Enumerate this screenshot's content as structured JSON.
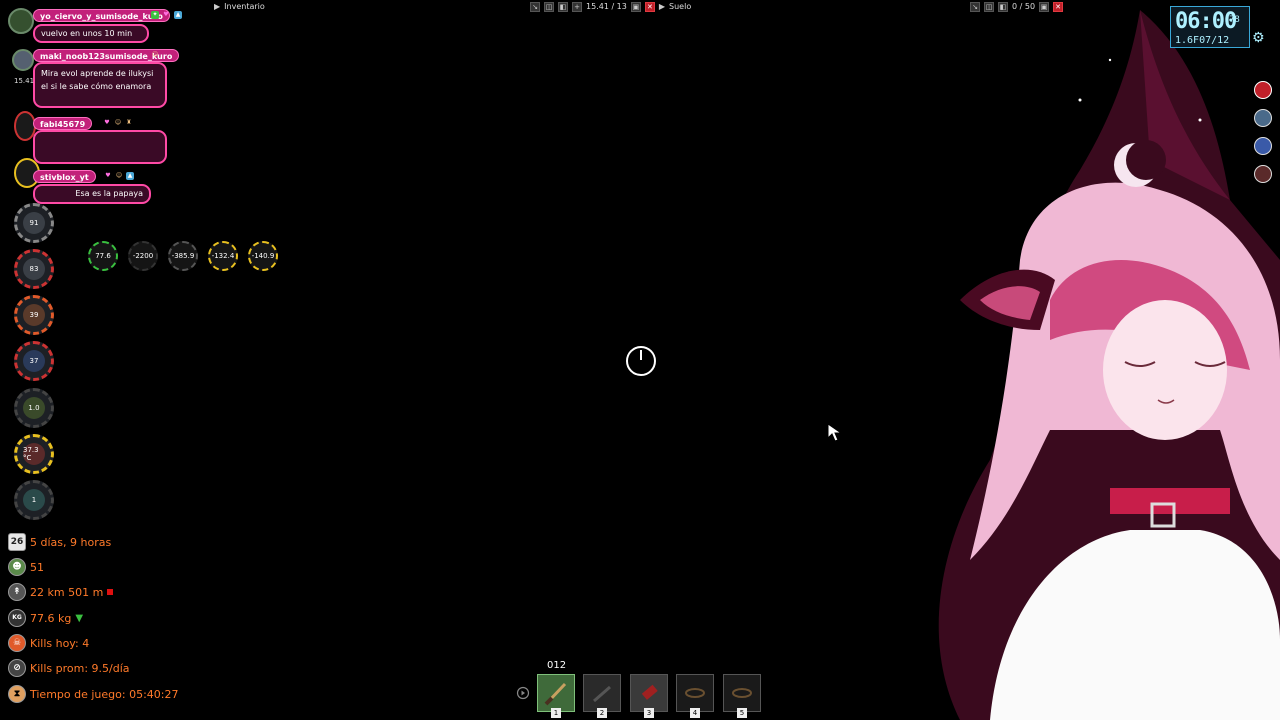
{
  "top_bar": {
    "inventory_label": "Inventario",
    "weight_readout": "15.41 / 13",
    "floor_label": "Suelo",
    "floor_readout": "0 / 50"
  },
  "chat": [
    {
      "user": "yo_ciervo_y_sumisode_kuro",
      "message": "vuelvo en unos 10 min"
    },
    {
      "user": "maki_noob123sumisode_kuro",
      "message": "Mira evol aprende de ilukysi el si le sabe cómo enamora"
    },
    {
      "user": "fabi45679",
      "message": ""
    },
    {
      "user": "stivblox_yt",
      "message": "Esa es la papaya"
    }
  ],
  "avatar_readout": "15.41",
  "status_gauges": [
    {
      "name": "battery",
      "value": "91",
      "color": "#7a7a7a"
    },
    {
      "name": "health",
      "value": "83",
      "color": "#cc3333"
    },
    {
      "name": "hunger",
      "value": "39",
      "color": "#e05a2a"
    },
    {
      "name": "thirst",
      "value": "37",
      "color": "#cc3333"
    },
    {
      "name": "stamina",
      "value": "1.0",
      "color": "#4a4a4a"
    },
    {
      "name": "temperature",
      "value": "37.3 °C",
      "color": "#e8c020"
    },
    {
      "name": "toilet",
      "value": "1",
      "color": "#4a4a4a"
    }
  ],
  "mini_gauges": [
    "77.6",
    "-2200",
    "-385.9",
    "-132.4",
    "-140.9"
  ],
  "stats": [
    {
      "icon": "calendar-icon",
      "glyph": "26",
      "text": "5 días, 9 horas"
    },
    {
      "icon": "zombie-icon",
      "glyph": "☻",
      "text": "51"
    },
    {
      "icon": "distance-icon",
      "glyph": "↟",
      "text": "22 km 501 m"
    },
    {
      "icon": "weight-icon",
      "glyph": "KG",
      "text": "77.6 kg"
    },
    {
      "icon": "kills-today-icon",
      "glyph": "☠",
      "text": "Kills hoy: 4"
    },
    {
      "icon": "kills-average-icon",
      "glyph": "⊘",
      "text": "Kills prom: 9.5/día"
    },
    {
      "icon": "playtime-icon",
      "glyph": "⧗",
      "text": "Tiempo de juego: 05:40:27"
    }
  ],
  "hotbar": {
    "ammo_label": "012",
    "slots": [
      "1",
      "2",
      "3",
      "4",
      "5"
    ]
  },
  "clock": {
    "time": "06:00",
    "seconds": "78",
    "date": "1.6F07/12"
  },
  "colors": {
    "chat_accent": "#ff4aa6",
    "stat_text": "#ff7a2a",
    "clock_text": "#aef0ff"
  }
}
